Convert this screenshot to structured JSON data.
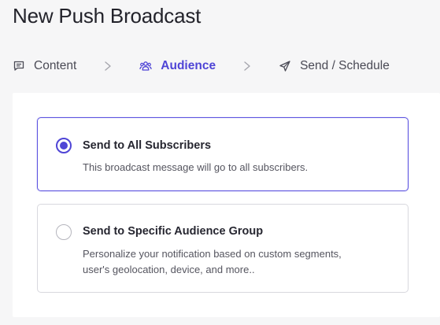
{
  "page": {
    "title": "New Push Broadcast"
  },
  "steps": [
    {
      "label": "Content",
      "icon": "message-icon",
      "active": false
    },
    {
      "label": "Audience",
      "icon": "users-icon",
      "active": true
    },
    {
      "label": "Send / Schedule",
      "icon": "send-icon",
      "active": false
    }
  ],
  "options": [
    {
      "title": "Send to All Subscribers",
      "description": "This broadcast message will go to all subscribers.",
      "selected": true
    },
    {
      "title": "Send to Specific Audience Group",
      "description": "Personalize your notification based on custom segments, user's geolocation, device, and more..",
      "selected": false
    }
  ],
  "colors": {
    "accent": "#4f45d6",
    "background": "#f6f6f7",
    "panel": "#ffffff"
  }
}
